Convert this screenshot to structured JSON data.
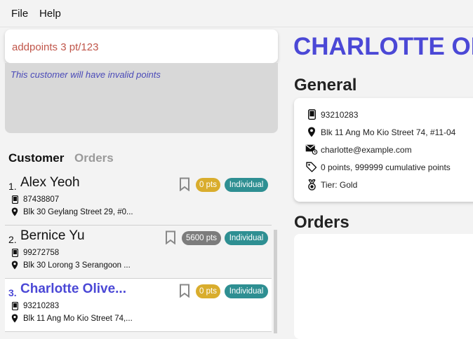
{
  "menu": {
    "file": "File",
    "help": "Help"
  },
  "command": {
    "value": "addpoints 3 pt/123"
  },
  "result": {
    "message": "This customer will have invalid points"
  },
  "tabs": {
    "customer": "Customer",
    "orders": "Orders"
  },
  "customers": [
    {
      "index": "1.",
      "name": "Alex Yeoh",
      "phone": "87438807",
      "address": "Blk 30 Geylang Street 29, #0...",
      "points": "0 pts",
      "tier": "Individual"
    },
    {
      "index": "2.",
      "name": "Bernice Yu",
      "phone": "99272758",
      "address": "Blk 30 Lorong 3 Serangoon ...",
      "points": "5600 pts",
      "tier": "Individual"
    },
    {
      "index": "3.",
      "name": "Charlotte Olive...",
      "phone": "93210283",
      "address": "Blk 11 Ang Mo Kio Street 74,...",
      "points": "0 pts",
      "tier": "Individual"
    }
  ],
  "detail": {
    "name": "CHARLOTTE OL",
    "general_title": "General",
    "phone": "93210283",
    "address": "Blk 11 Ang Mo Kio Street 74, #11-04",
    "email": "charlotte@example.com",
    "points": "0 points, 999999 cumulative points",
    "tier": "Tier: Gold",
    "orders_title": "Orders"
  },
  "colors": {
    "accent": "#4b48d6",
    "command_text": "#c0564a",
    "points_gold": "#d9ad2d",
    "points_grey": "#7c7c7c",
    "tier_badge": "#2e8f92"
  },
  "icons": [
    "phone-icon",
    "location-pin-icon",
    "email-icon",
    "tag-icon",
    "medal-icon",
    "bookmark-icon"
  ]
}
